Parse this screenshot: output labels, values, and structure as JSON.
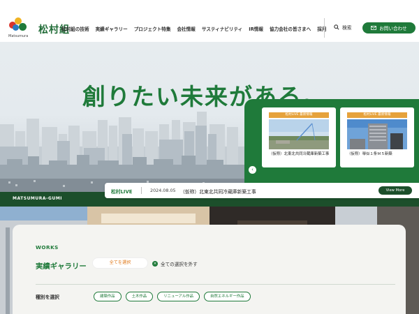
{
  "header": {
    "logo_text": "松村組",
    "logo_sub": "Matsumura",
    "nav_items": [
      "松村組の技術",
      "実績ギャラリー",
      "プロジェクト特集",
      "会社情報",
      "サスティナビリティ",
      "IR情報",
      "協力会社の皆さまへ",
      "採用"
    ],
    "search_label": "検索",
    "contact_label": "お問い合わせ"
  },
  "hero": {
    "catchphrase": "創りたい未来がある。",
    "brand": "MATSUMURA-GUMI"
  },
  "live": {
    "cards": [
      {
        "badge": "松村LIVE 最新情報",
        "caption": "（仮称）北東北共同冷蔵庫新築工事"
      },
      {
        "badge": "松村LIVE 最新情報",
        "caption": "（仮称）琴似１条ＭＳ新築"
      }
    ]
  },
  "news": {
    "label": "松村LIVE",
    "date": "2024.08.05",
    "title": "（仮称）北東北共同冷蔵庫新築工事",
    "view_more": "View More"
  },
  "works": {
    "label": "WORKS",
    "title": "実績ギャラリー",
    "select_all": "全てを選択",
    "clear_all": "全ての選択を外す",
    "type_label": "種別を選択",
    "chips": [
      "建築作品",
      "土木作品",
      "リニューアル作品",
      "自然エネルギー作品"
    ]
  },
  "colors": {
    "brand_green": "#1f7a3a",
    "dark_green": "#1c4f2b",
    "accent_orange": "#e6a23c"
  }
}
